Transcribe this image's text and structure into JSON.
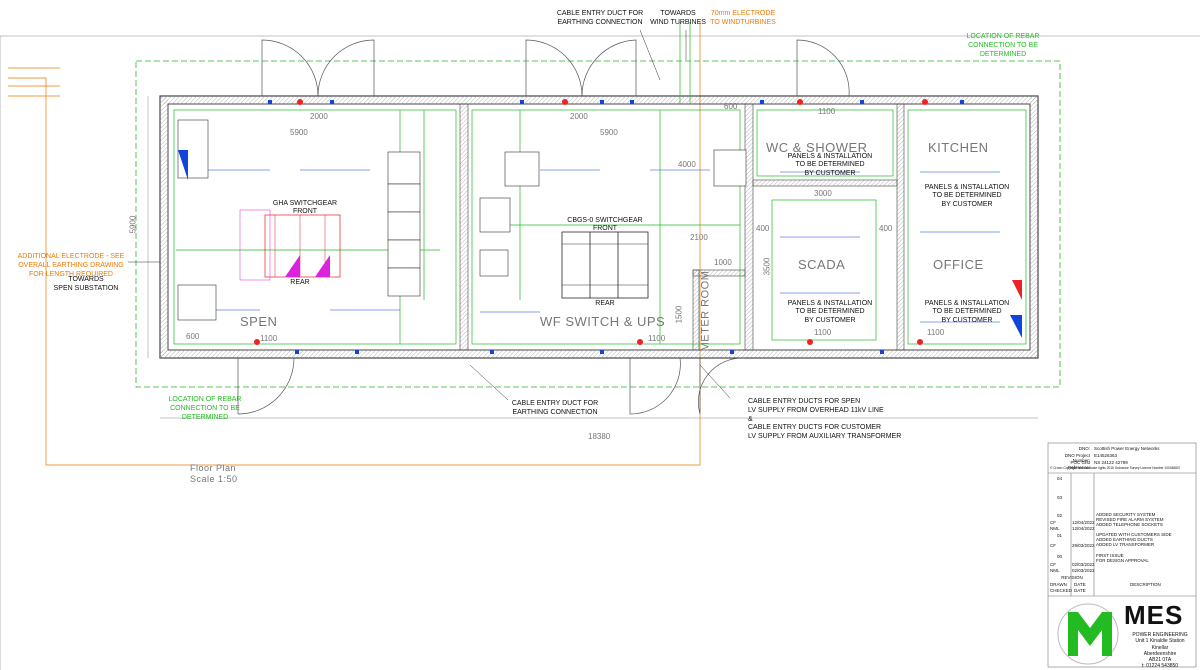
{
  "annotations": {
    "cable_duct_top": "CABLE ENTRY DUCT FOR\nEARTHING CONNECTION",
    "towards_wind": "TOWARDS\nWIND TURBINES",
    "electrode_70mm": "70mm ELECTRODE\nTO WINDTURBINES",
    "rebar_top": "LOCATION OF REBAR\nCONNECTION TO BE\nDETERMINED",
    "additional_electrode": "ADDITIONAL ELECTRODE - SEE\nOVERALL EARTHING DRAWING\nFOR LENGTH REQUIRED",
    "towards_spen": "TOWARDS\nSPEN SUBSTATION",
    "rebar_bottom": "LOCATION OF REBAR\nCONNECTION TO BE\nDETERMINED",
    "cable_duct_bottom": "CABLE ENTRY DUCT FOR\nEARTHING CONNECTION",
    "cable_ducts_spen": "CABLE ENTRY DUCTS FOR SPEN\nLV SUPPLY FROM OVERHEAD 11kV LINE\n&\nCABLE ENTRY DUCTS FOR CUSTOMER\nLV SUPPLY FROM AUXILIARY TRANSFORMER",
    "floor_plan": "Floor Plan",
    "scale": "Scale 1:50"
  },
  "rooms": {
    "spen": "SPEN",
    "wf_switch": "WF SWITCH & UPS",
    "wc_shower": "WC & SHOWER",
    "kitchen": "KITCHEN",
    "scada": "SCADA",
    "office": "OFFICE",
    "meter_room": "METER ROOM"
  },
  "room_notes": {
    "wc": "PANELS & INSTALLATION\nTO BE DETERMINED\nBY CUSTOMER",
    "kitchen": "PANELS & INSTALLATION\nTO BE DETERMINED\nBY CUSTOMER",
    "scada": "PANELS & INSTALLATION\nTO BE DETERMINED\nBY CUSTOMER",
    "office": "PANELS & INSTALLATION\nTO BE DETERMINED\nBY CUSTOMER"
  },
  "equipment": {
    "gha_switchgear": "GHA SWITCHGEAR\nFRONT",
    "gha_rear": "REAR",
    "cbgs_switchgear": "CBGS-0 SWITCHGEAR\nFRONT",
    "cbgs_rear": "REAR"
  },
  "dimensions": {
    "overall_length": "18380",
    "left_width": "5900",
    "room_top_left": "2000",
    "room_top_mid": "2000",
    "spen_5900": "5900",
    "wf_5900": "5900",
    "wc_1100": "1100",
    "scada_3000": "3000",
    "scada_3500": "3500",
    "scada_1100": "1100",
    "office_1100": "1100",
    "wf_1100": "1100",
    "spen_1100": "1100",
    "meter_1500": "1500",
    "d4000": "4000",
    "d2100": "2100",
    "d1000": "1000",
    "d400a": "400",
    "d400b": "400",
    "d600a": "600",
    "d600b": "600"
  },
  "title_block": {
    "dno_label": "DNO:",
    "dno_value": "Scottish Power Energy Networks",
    "project_label": "DNO Project Number:",
    "project_value": "E14526363",
    "grid_label": "POC Grid Reference:",
    "grid_value": "NS 24122 42799",
    "copyright": "© Crown Copyright and database rights 2016 Ordnance Survey Licence Number 100048807",
    "rev_04": "04",
    "rev_03": "03",
    "rev_02": "02",
    "rev_02_desc": "ADDED SECURITY SYSTEM\nREVISED FIRE ALARM SYSTEM\nADDED TELEPHONE SOCKETS",
    "rev_02_cf": "CF",
    "rev_02_d1": "12/04/2022",
    "rev_02_nml": "NML",
    "rev_02_d2": "12/04/2022",
    "rev_01": "01",
    "rev_01_desc": "UPDATED WITH CUSTOMERS SIDE\nADDED EARTHING DUCTS\nADDED LV TRANSFORMER",
    "rev_01_cf": "CF",
    "rev_01_d1": "29/03/2022",
    "rev_00": "00",
    "rev_00_desc": "FIRST ISSUE\nFOR DESIGN APPROVAL",
    "rev_00_cf": "CF",
    "rev_00_d1": "02/03/2022",
    "rev_00_nml": "NML",
    "rev_00_d2": "02/03/2022",
    "revision": "REVISION",
    "drawn": "DRAWN",
    "checked": "CHECKED",
    "date": "DATE",
    "description": "DESCRIPTION"
  },
  "company": {
    "name": "MES",
    "sub": "POWER ENGINEERING\nUnit 1 Kinaldie Station\nKinellar\nAberdeenshire\nAB21 0TA\nt: 01224 543850"
  },
  "colors": {
    "wall": "#444444",
    "green": "#22bb22",
    "orange": "#ee7a00",
    "blue": "#1144dd",
    "red": "#ee2222",
    "magenta": "#dd22dd"
  }
}
